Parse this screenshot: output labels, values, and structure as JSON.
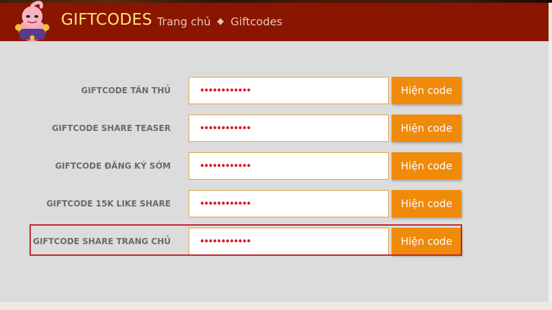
{
  "header": {
    "title": "GIFTCODES",
    "breadcrumb": [
      "Trang chủ",
      "Giftcodes"
    ]
  },
  "rows": [
    {
      "label": "GIFTCODE TÂN THỦ",
      "value": "••••••••••••",
      "button": "Hiện code"
    },
    {
      "label": "GIFTCODE SHARE TEASER",
      "value": "••••••••••••",
      "button": "Hiện code"
    },
    {
      "label": "GIFTCODE ĐĂNG KÝ SỚM",
      "value": "••••••••••••",
      "button": "Hiện code"
    },
    {
      "label": "GIFTCODE 15K LIKE SHARE",
      "value": "••••••••••••",
      "button": "Hiện code"
    },
    {
      "label": "GIFTCODE SHARE TRANG CHỦ",
      "value": "••••••••••••",
      "button": "Hiện code"
    }
  ],
  "colors": {
    "header_bg": "#8a1500",
    "brand_text": "#ffe27a",
    "button_bg": "#f08a0a",
    "input_border": "#e0a040",
    "highlight_border": "#c0242e"
  },
  "icons": {
    "mascot": "buu-mascot-icon"
  }
}
